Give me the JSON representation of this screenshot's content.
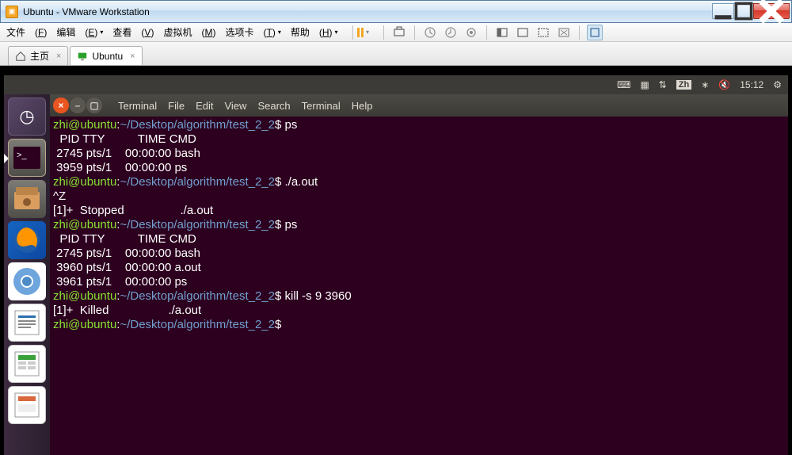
{
  "window": {
    "title": "Ubuntu - VMware Workstation"
  },
  "menu": {
    "file": "文件",
    "file_u": "F",
    "edit": "编辑",
    "edit_u": "E",
    "view": "查看",
    "view_u": "V",
    "vm": "虚拟机",
    "vm_u": "M",
    "tabs": "选项卡",
    "tabs_u": "T",
    "help": "帮助",
    "help_u": "H"
  },
  "tabs": {
    "home": "主页",
    "ubuntu": "Ubuntu"
  },
  "ubuntu_panel": {
    "lang": "Zh",
    "time": "15:12"
  },
  "term_menu": {
    "terminal1": "Terminal",
    "file": "File",
    "edit": "Edit",
    "view": "View",
    "search": "Search",
    "terminal2": "Terminal",
    "help": "Help"
  },
  "term": {
    "user": "zhi@ubuntu",
    "path": "~/Desktop/algorithm/test_2_2",
    "dollar": "$",
    "cmd_ps": "ps",
    "hdr": "  PID TTY          TIME CMD",
    "row_2745_bash": " 2745 pts/1    00:00:00 bash",
    "row_3959_ps": " 3959 pts/1    00:00:00 ps",
    "cmd_aout": "./a.out",
    "ctrlz": "^Z",
    "stopped": "[1]+  Stopped                 ./a.out",
    "row_3960_aout": " 3960 pts/1    00:00:00 a.out",
    "row_3961_ps": " 3961 pts/1    00:00:00 ps",
    "cmd_kill": "kill -s 9 3960",
    "killed": "[1]+  Killed                  ./a.out"
  }
}
